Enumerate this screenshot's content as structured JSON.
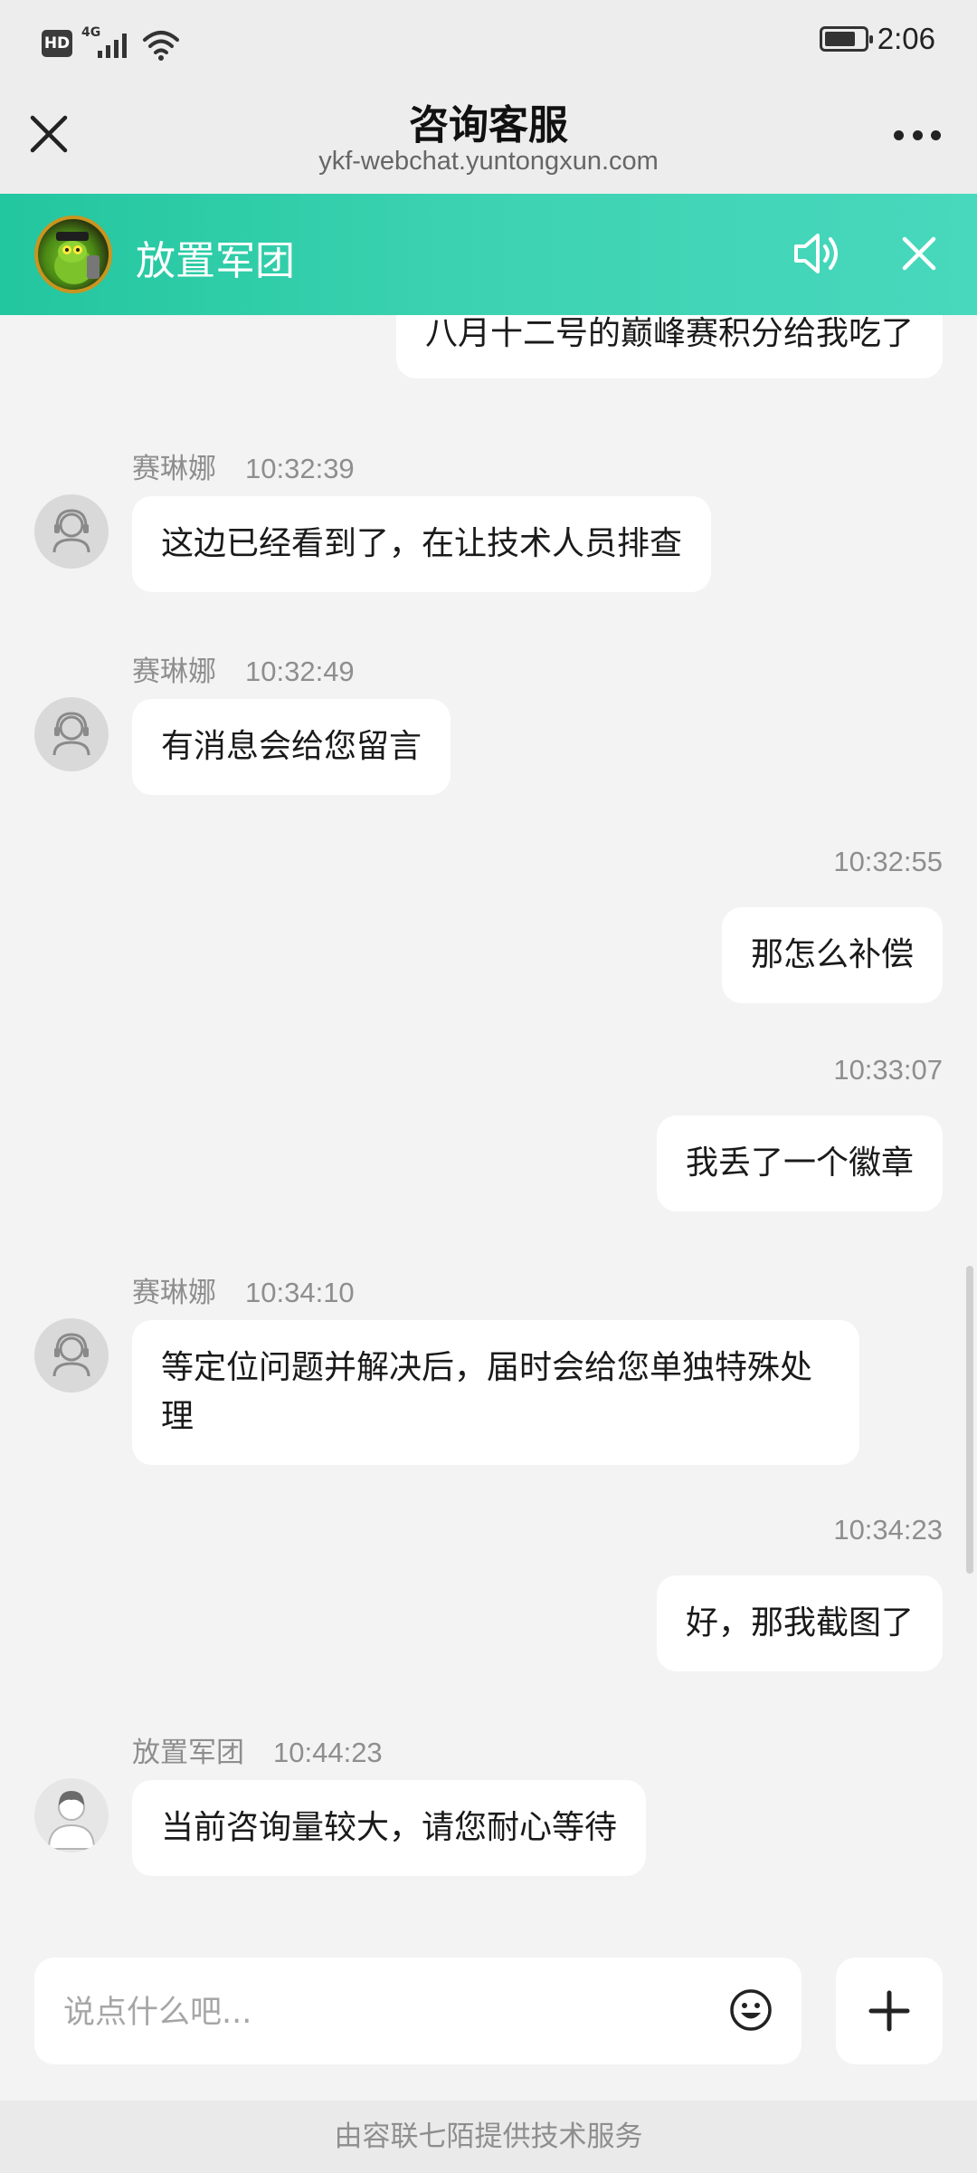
{
  "status_bar": {
    "hd": "HD",
    "network": "4G",
    "time": "2:06"
  },
  "header": {
    "title": "咨询客服",
    "url": "ykf-webchat.yuntongxun.com"
  },
  "banner": {
    "title": "放置军团",
    "accent_color": "#2cc9a5"
  },
  "messages": [
    {
      "side": "right",
      "text": "八月十二号的巅峰赛积分给我吃了"
    },
    {
      "side": "left",
      "sender": "赛琳娜",
      "time": "10:32:39",
      "text": "这边已经看到了，在让技术人员排查"
    },
    {
      "side": "left",
      "sender": "赛琳娜",
      "time": "10:32:49",
      "text": "有消息会给您留言"
    },
    {
      "side": "right",
      "time": "10:32:55",
      "text": "那怎么补偿"
    },
    {
      "side": "right",
      "time": "10:33:07",
      "text": "我丢了一个徽章"
    },
    {
      "side": "left",
      "sender": "赛琳娜",
      "time": "10:34:10",
      "text": "等定位问题并解决后，届时会给您单独特殊处理"
    },
    {
      "side": "right",
      "time": "10:34:23",
      "text": "好，那我截图了"
    },
    {
      "side": "left",
      "sender": "放置军团",
      "time": "10:44:23",
      "text": "当前咨询量较大，请您耐心等待"
    }
  ],
  "composer": {
    "placeholder": "说点什么吧..."
  },
  "footer": {
    "text": "由容联七陌提供技术服务"
  }
}
